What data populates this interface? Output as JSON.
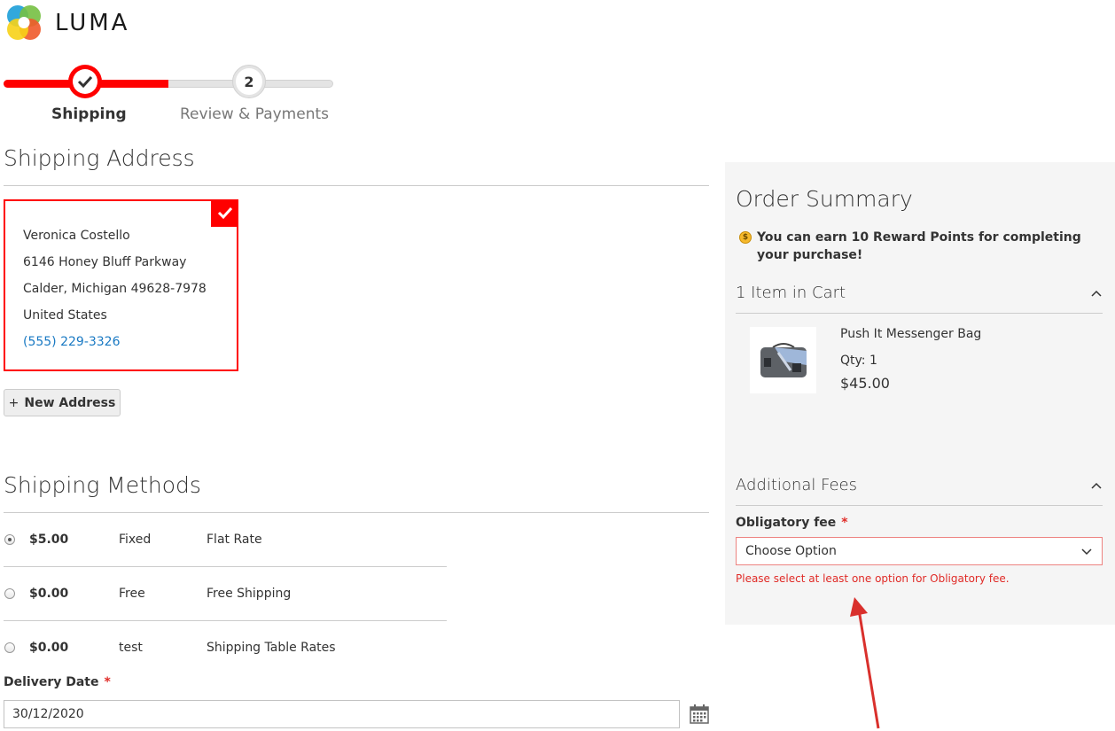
{
  "logo": {
    "text": "LUMA"
  },
  "progress": {
    "steps": [
      {
        "label": "Shipping",
        "state": "complete"
      },
      {
        "label": "Review & Payments",
        "number": "2",
        "state": "pending"
      }
    ]
  },
  "shipping_address": {
    "title": "Shipping Address",
    "address": {
      "name": "Veronica Costello",
      "street": "6146 Honey Bluff Parkway",
      "city_line": "Calder, Michigan 49628-7978",
      "country": "United States",
      "phone": "(555) 229-3326"
    },
    "new_address_label": "New Address"
  },
  "shipping_methods": {
    "title": "Shipping Methods",
    "rows": [
      {
        "price": "$5.00",
        "type": "Fixed",
        "carrier": "Flat Rate",
        "selected": true
      },
      {
        "price": "$0.00",
        "type": "Free",
        "carrier": "Free Shipping",
        "selected": false
      },
      {
        "price": "$0.00",
        "type": "test",
        "carrier": "Shipping Table Rates",
        "selected": false
      }
    ],
    "delivery_date": {
      "label": "Delivery Date",
      "required_mark": "*",
      "value": "30/12/2020"
    }
  },
  "order_summary": {
    "title": "Order Summary",
    "reward_prefix": "You can earn ",
    "reward_points": "10 Reward Points",
    "reward_suffix": " for completing your purchase!",
    "cart_header": "1 Item in Cart",
    "item": {
      "name": "Push It Messenger Bag",
      "qty": "Qty: 1",
      "price": "$45.00"
    },
    "fees_header": "Additional Fees",
    "fee_label": "Obligatory fee",
    "fee_required_mark": "*",
    "fee_select_value": "Choose Option",
    "fee_error": "Please select at least one option for Obligatory fee."
  },
  "colors": {
    "accent": "#ff0000",
    "link": "#1979c3",
    "error": "#e02b27",
    "summary_bg": "#f5f5f5"
  }
}
